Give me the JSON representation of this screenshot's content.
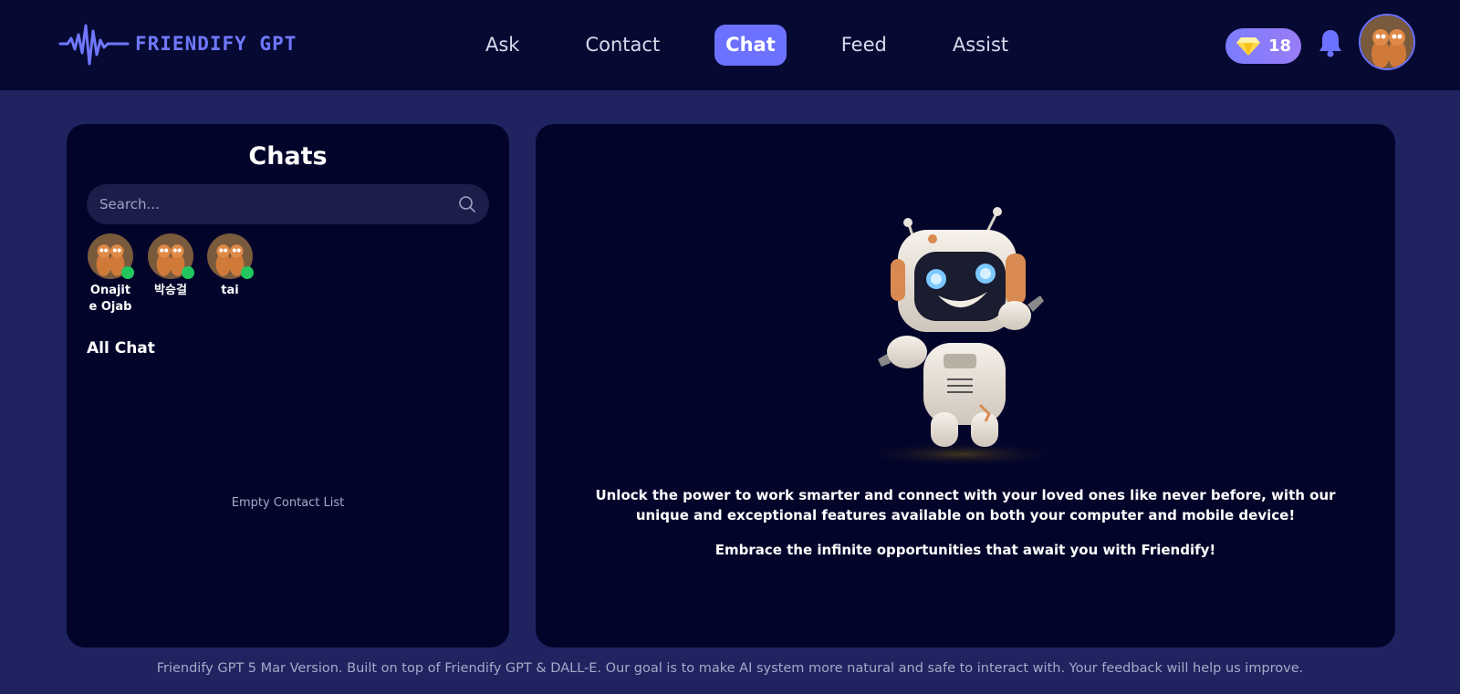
{
  "header": {
    "logo_text": "Friendify GPT",
    "nav": [
      {
        "label": "Ask",
        "active": false
      },
      {
        "label": "Contact",
        "active": false
      },
      {
        "label": "Chat",
        "active": true
      },
      {
        "label": "Feed",
        "active": false
      },
      {
        "label": "Assist",
        "active": false
      }
    ],
    "gem_count": "18",
    "accent_color": "#6c72ff"
  },
  "chats_panel": {
    "title": "Chats",
    "search": {
      "placeholder": "Search...",
      "value": ""
    },
    "contacts": [
      {
        "name": "Onajite Ojabacł",
        "online": true
      },
      {
        "name": "박승걸",
        "online": true
      },
      {
        "name": "tai",
        "online": true
      }
    ],
    "section_label": "All Chat",
    "empty_message": "Empty Contact List"
  },
  "welcome_panel": {
    "message_1": "Unlock the power to work smarter and connect with your loved ones like never before, with our unique and exceptional features available on both your computer and mobile device!",
    "message_2": "Embrace the infinite opportunities that await you with Friendify!"
  },
  "footer": {
    "text": "Friendify GPT 5 Mar Version. Built on top of Friendify GPT & DALL-E. Our goal is to make AI system more natural and safe to interact with. Your feedback will help us improve."
  },
  "icons": [
    "waveform-logo-icon",
    "gem-icon",
    "bell-icon",
    "search-icon",
    "robot-illustration"
  ]
}
